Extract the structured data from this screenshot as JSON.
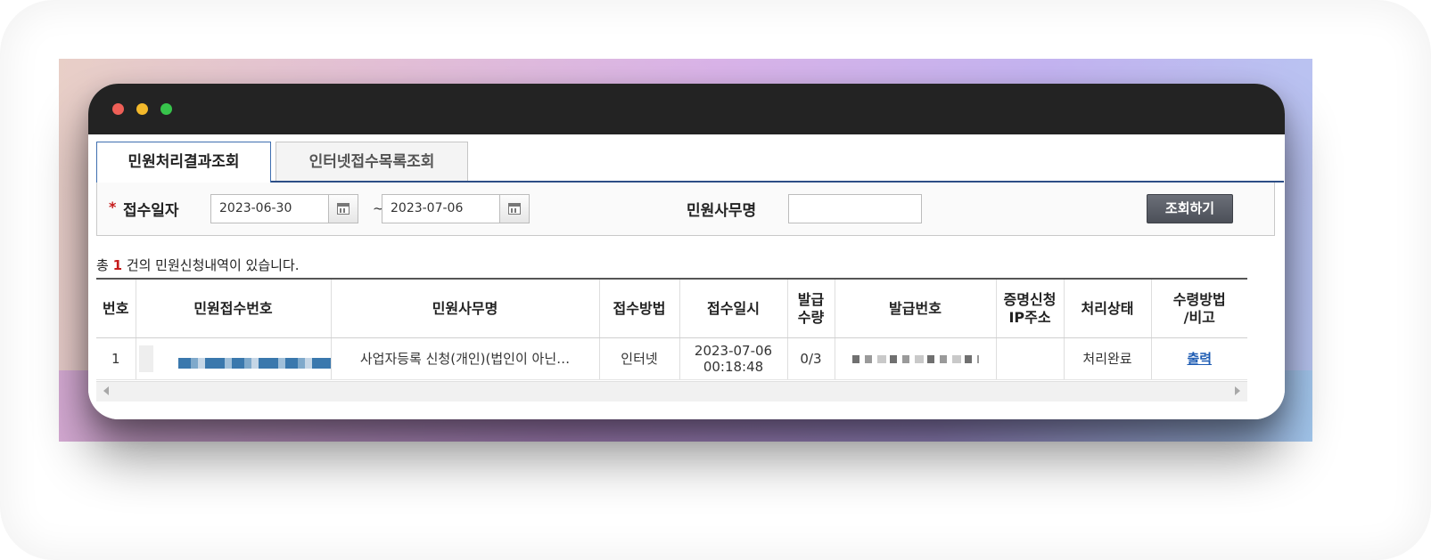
{
  "tabs": [
    {
      "label": "민원처리결과조회",
      "active": true
    },
    {
      "label": "인터넷접수목록조회",
      "active": false
    }
  ],
  "search": {
    "required_mark": "*",
    "date_label": "접수일자",
    "date_from": "2023-06-30",
    "date_to": "2023-07-06",
    "range_separator": "~",
    "name_label": "민원사무명",
    "name_value": "",
    "button_label": "조회하기"
  },
  "summary": {
    "prefix": "총",
    "count": "1",
    "suffix": "건의 민원신청내역이 있습니다."
  },
  "table": {
    "headers": [
      "번호",
      "민원접수번호",
      "민원사무명",
      "접수방법",
      "접수일시",
      "발급\n수량",
      "발급번호",
      "증명신청\nIP주소",
      "처리상태",
      "수령방법\n/비고"
    ],
    "rows": [
      {
        "no": "1",
        "receipt_no": "",
        "service_name": "사업자등록 신청(개인)(법인이 아닌…",
        "method": "인터넷",
        "received_date": "2023-07-06",
        "received_time": "00:18:48",
        "issue_qty": "0/3",
        "issue_no": "",
        "ip": "",
        "status": "처리완료",
        "remark": "출력"
      }
    ]
  },
  "colors": {
    "titlebar": "#232323",
    "accent_blue": "#2d4e86",
    "required_red": "#c51a1a",
    "search_button": "#555960"
  }
}
